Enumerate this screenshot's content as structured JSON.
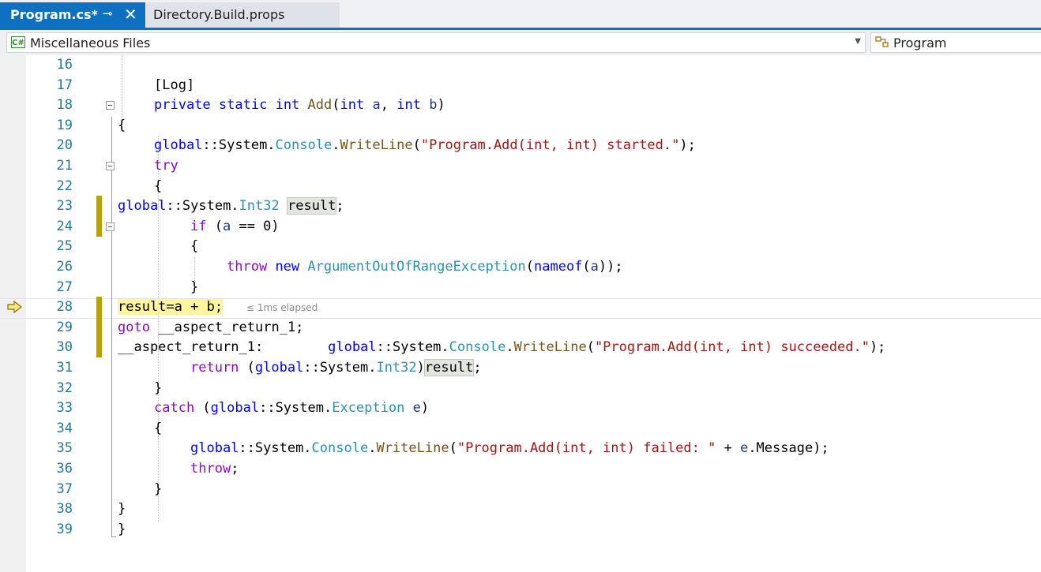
{
  "tabs": [
    {
      "title": "Program.cs*",
      "active": true,
      "pin_icon": "pin-icon",
      "close_icon": "close-icon"
    },
    {
      "title": "Directory.Build.props",
      "active": false
    }
  ],
  "navbar": {
    "project": "Miscellaneous Files",
    "project_icon": "C#",
    "type": "Program"
  },
  "editor": {
    "current_line": 28,
    "elapsed": "≤ 1ms elapsed",
    "lines": [
      {
        "n": "16",
        "text": ""
      },
      {
        "n": "17",
        "text": "[Log]"
      },
      {
        "n": "18",
        "text": "private static int Add(int a, int b)"
      },
      {
        "n": "19",
        "text": "{"
      },
      {
        "n": "20",
        "text": "global::System.Console.WriteLine(\"Program.Add(int, int) started.\");"
      },
      {
        "n": "21",
        "text": "try"
      },
      {
        "n": "22",
        "text": "{"
      },
      {
        "n": "23",
        "text": "global::System.Int32 result;"
      },
      {
        "n": "24",
        "text": "if (a == 0)"
      },
      {
        "n": "25",
        "text": "{"
      },
      {
        "n": "26",
        "text": "throw new ArgumentOutOfRangeException(nameof(a));"
      },
      {
        "n": "27",
        "text": "}"
      },
      {
        "n": "28",
        "text": "result=a + b;"
      },
      {
        "n": "29",
        "text": "goto __aspect_return_1;"
      },
      {
        "n": "30",
        "text": "__aspect_return_1:        global::System.Console.WriteLine(\"Program.Add(int, int) succeeded.\");"
      },
      {
        "n": "31",
        "text": "return (global::System.Int32)result;"
      },
      {
        "n": "32",
        "text": "}"
      },
      {
        "n": "33",
        "text": "catch (global::System.Exception e)"
      },
      {
        "n": "34",
        "text": "{"
      },
      {
        "n": "35",
        "text": "global::System.Console.WriteLine(\"Program.Add(int, int) failed: \" + e.Message);"
      },
      {
        "n": "36",
        "text": "throw;"
      },
      {
        "n": "37",
        "text": "}"
      },
      {
        "n": "38",
        "text": "}"
      },
      {
        "n": "39",
        "text": "}"
      }
    ]
  },
  "colors": {
    "accent": "#0e70c0",
    "keyword": "#0000ff",
    "control": "#8f08c4",
    "type": "#2b91af",
    "string": "#a31515",
    "method": "#74531f",
    "param": "#1f377f",
    "change_marker": "#b8a10c",
    "current_statement": "#fff59d"
  }
}
